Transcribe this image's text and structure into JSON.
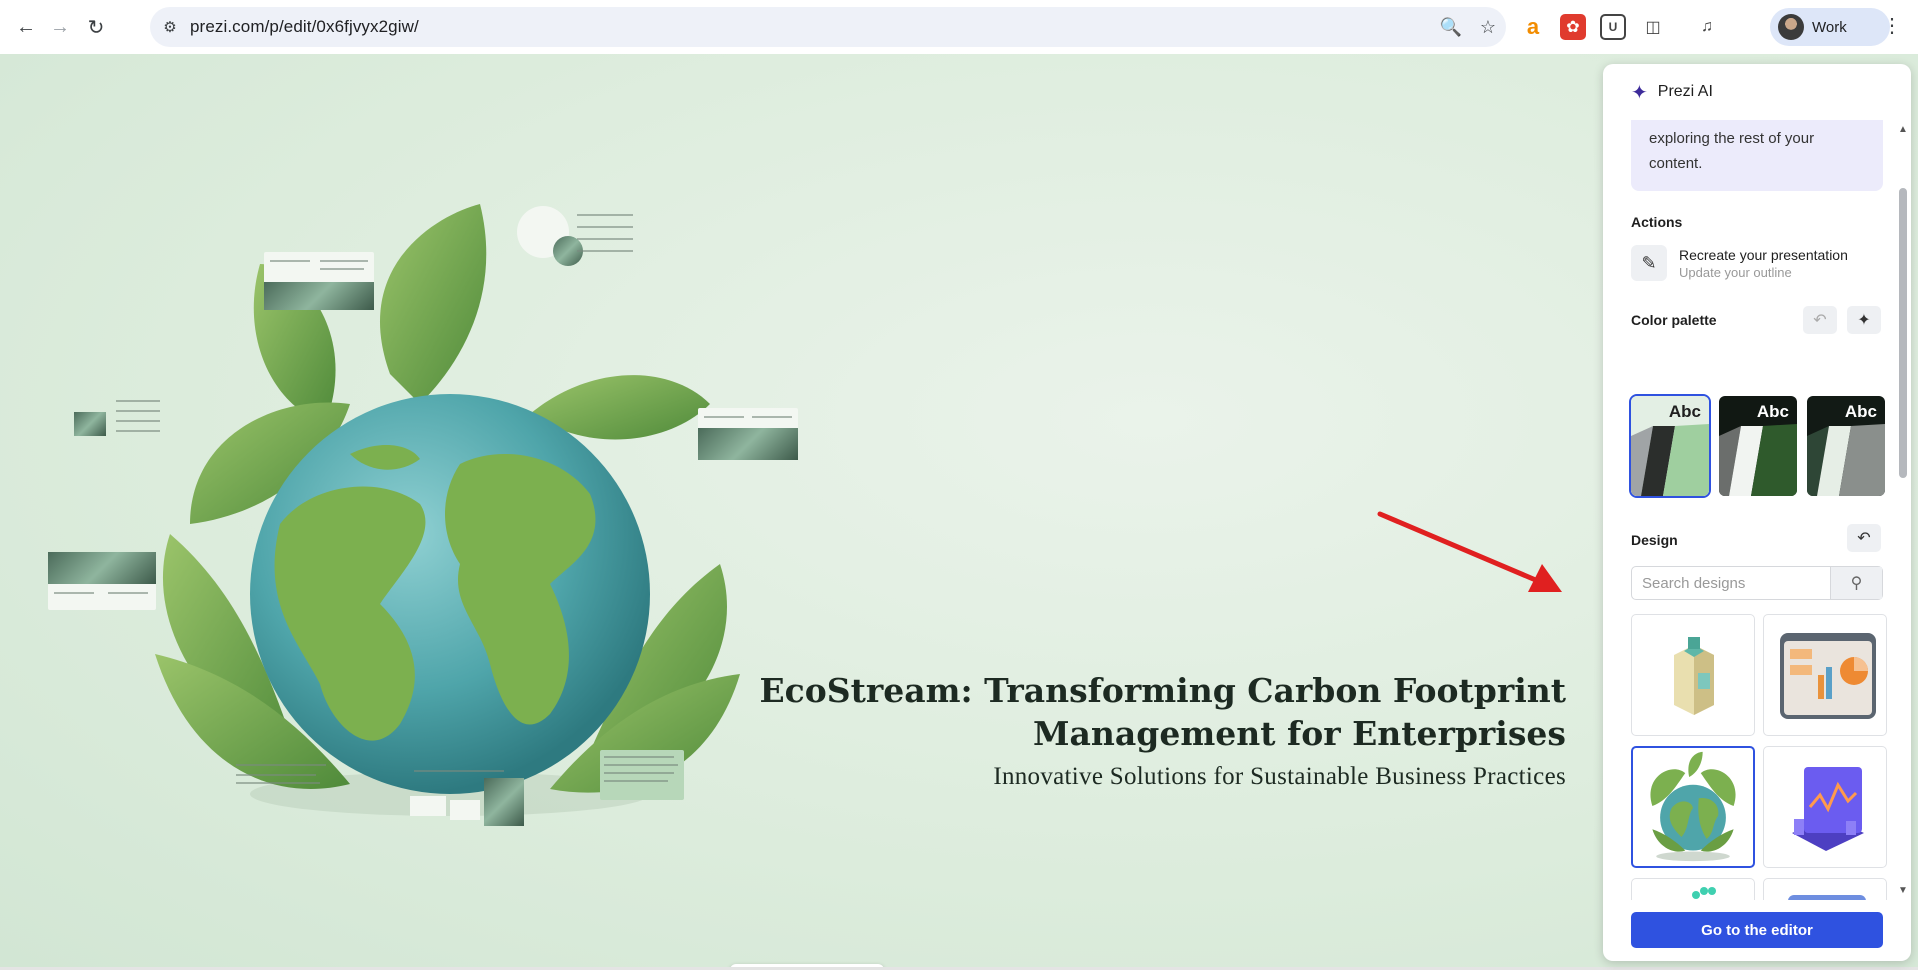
{
  "browser": {
    "url": "prezi.com/p/edit/0x6fjvyx2giw/",
    "profile_label": "Work"
  },
  "presentation": {
    "title_line1": "EcoStream: Transforming Carbon Footprint",
    "title_line2": "Management for Enterprises",
    "subtitle": "Innovative Solutions for Sustainable Business Practices"
  },
  "panel": {
    "title": "Prezi AI",
    "message": "exploring the rest of your content.",
    "actions_title": "Actions",
    "action": {
      "title": "Recreate your presentation",
      "subtitle": "Update your outline"
    },
    "palette_title": "Color palette",
    "palettes": [
      {
        "label": "Abc"
      },
      {
        "label": "Abc"
      },
      {
        "label": "Abc"
      }
    ],
    "design_title": "Design",
    "search_placeholder": "Search designs",
    "editor_button": "Go to the editor"
  },
  "colors": {
    "accent": "#2f52e0",
    "annotation_arrow": "#e02020",
    "panel_message_bg": "#ecebfb"
  }
}
